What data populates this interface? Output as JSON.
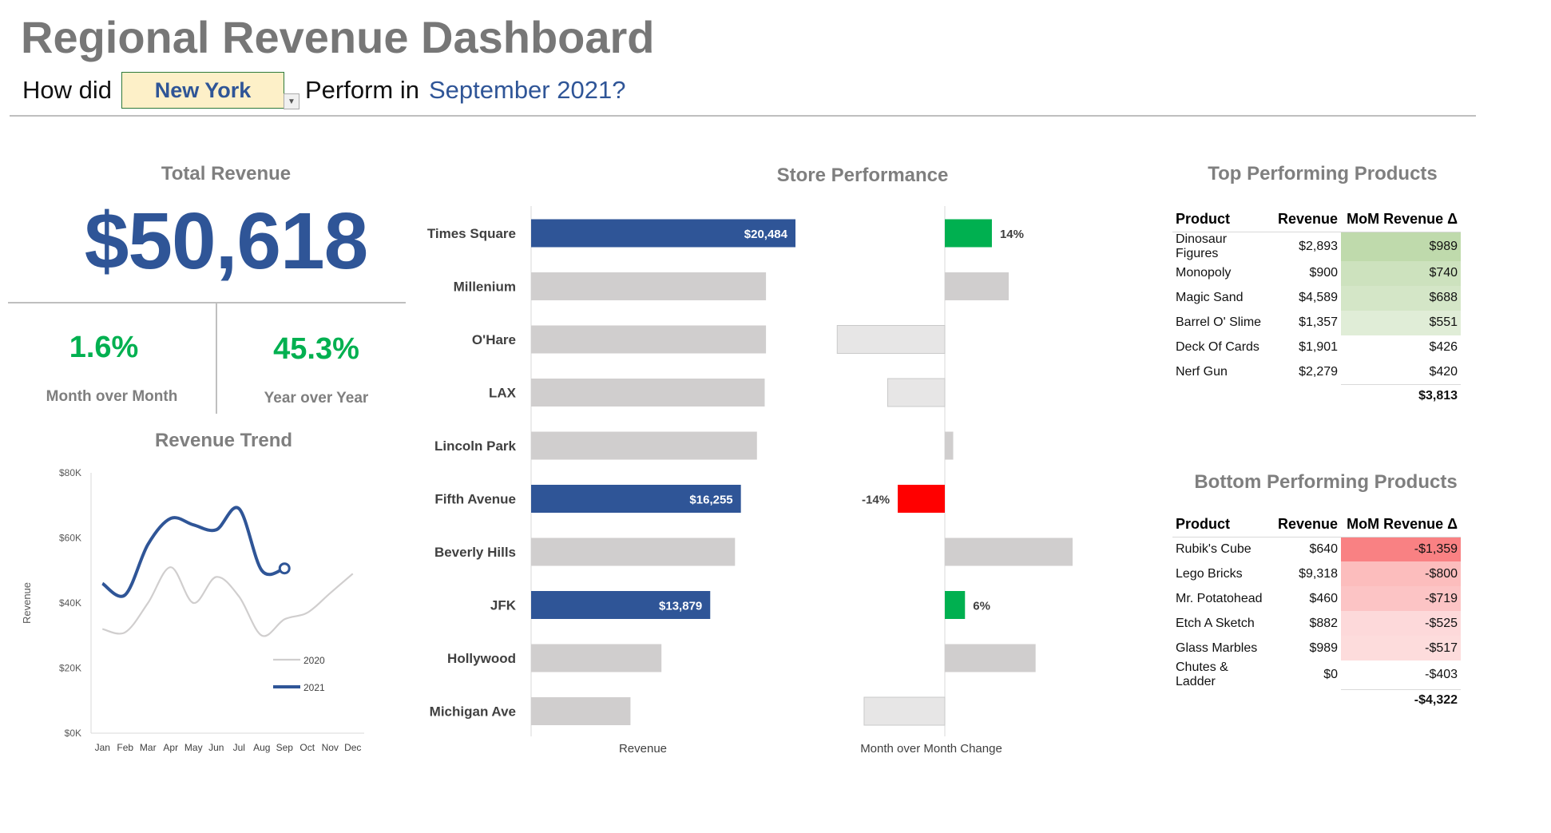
{
  "header": {
    "title": "Regional Revenue Dashboard",
    "question_prefix": "How did",
    "selected_city": "New York",
    "question_middle": "Perform in",
    "period": "September 2021?"
  },
  "total_revenue": {
    "title": "Total Revenue",
    "value": "$50,618",
    "mom_value": "1.6%",
    "mom_label": "Month over Month",
    "yoy_value": "45.3%",
    "yoy_label": "Year over Year"
  },
  "colors": {
    "accent_blue": "#2f5597",
    "positive_green": "#00b050",
    "negative_red": "#ff0000",
    "bar_grey": "#d0cece",
    "light_grey": "#e7e6e6",
    "title_grey": "#7f7f7f"
  },
  "chart_data": [
    {
      "type": "line",
      "title": "Revenue Trend",
      "ylabel": "Revenue",
      "categories": [
        "Jan",
        "Feb",
        "Mar",
        "Apr",
        "May",
        "Jun",
        "Jul",
        "Aug",
        "Sep",
        "Oct",
        "Nov",
        "Dec"
      ],
      "y_ticks": [
        "$0K",
        "$20K",
        "$40K",
        "$60K",
        "$80K"
      ],
      "ylim": [
        0,
        80000
      ],
      "legend_position": "bottom-right",
      "series": [
        {
          "name": "2020",
          "color": "#d0cece",
          "values": [
            32000,
            31000,
            40000,
            51000,
            40000,
            48000,
            42000,
            30000,
            35000,
            37000,
            43000,
            49000
          ]
        },
        {
          "name": "2021",
          "color": "#2f5597",
          "values": [
            46000,
            42500,
            58000,
            66000,
            64000,
            62500,
            69000,
            50000,
            50618,
            null,
            null,
            null
          ]
        }
      ]
    },
    {
      "type": "bar",
      "title": "Store Performance",
      "xlabel": "Revenue",
      "orientation": "horizontal",
      "categories": [
        "Times Square",
        "Millenium",
        "O'Hare",
        "LAX",
        "Lincoln Park",
        "Fifth Avenue",
        "Beverly Hills",
        "JFK",
        "Hollywood",
        "Michigan Ave"
      ],
      "values": [
        20484,
        18200,
        18200,
        18100,
        17500,
        16255,
        15800,
        13879,
        10100,
        7700
      ],
      "highlighted": [
        true,
        false,
        false,
        false,
        false,
        true,
        false,
        true,
        false,
        false
      ],
      "value_labels": [
        "$20,484",
        "",
        "",
        "",
        "",
        "$16,255",
        "",
        "$13,879",
        "",
        ""
      ]
    },
    {
      "type": "bar",
      "title": "",
      "xlabel": "Month over Month Change",
      "orientation": "horizontal",
      "categories": [
        "Times Square",
        "Millenium",
        "O'Hare",
        "LAX",
        "Lincoln Park",
        "Fifth Avenue",
        "Beverly Hills",
        "JFK",
        "Hollywood",
        "Michigan Ave"
      ],
      "values": [
        14,
        19,
        -32,
        -17,
        2.5,
        -14,
        38,
        6,
        27,
        -24
      ],
      "highlighted": [
        true,
        false,
        false,
        false,
        false,
        true,
        false,
        true,
        false,
        false
      ],
      "value_labels": [
        "14%",
        "",
        "",
        "",
        "",
        "-14%",
        "",
        "6%",
        "",
        ""
      ]
    }
  ],
  "top_products": {
    "title": "Top Performing Products",
    "columns": [
      "Product",
      "Revenue",
      "MoM Revenue Δ"
    ],
    "rows": [
      {
        "product": "Dinosaur Figures",
        "revenue": "$2,893",
        "delta": "$989",
        "intensity": 1.0
      },
      {
        "product": "Monopoly",
        "revenue": "$900",
        "delta": "$740",
        "intensity": 0.7
      },
      {
        "product": "Magic Sand",
        "revenue": "$4,589",
        "delta": "$688",
        "intensity": 0.55
      },
      {
        "product": "Barrel O' Slime",
        "revenue": "$1,357",
        "delta": "$551",
        "intensity": 0.3
      },
      {
        "product": "Deck Of Cards",
        "revenue": "$1,901",
        "delta": "$426",
        "intensity": 0.0
      },
      {
        "product": "Nerf Gun",
        "revenue": "$2,279",
        "delta": "$420",
        "intensity": 0.0
      }
    ],
    "total": "$3,813"
  },
  "bottom_products": {
    "title": "Bottom Performing Products",
    "columns": [
      "Product",
      "Revenue",
      "MoM Revenue Δ"
    ],
    "rows": [
      {
        "product": "Rubik's Cube",
        "revenue": "$640",
        "delta": "-$1,359",
        "intensity": 1.0
      },
      {
        "product": "Lego Bricks",
        "revenue": "$9,318",
        "delta": "-$800",
        "intensity": 0.45
      },
      {
        "product": "Mr. Potatohead",
        "revenue": "$460",
        "delta": "-$719",
        "intensity": 0.38
      },
      {
        "product": "Etch A Sketch",
        "revenue": "$882",
        "delta": "-$525",
        "intensity": 0.18
      },
      {
        "product": "Glass Marbles",
        "revenue": "$989",
        "delta": "-$517",
        "intensity": 0.16
      },
      {
        "product": "Chutes & Ladder",
        "revenue": "$0",
        "delta": "-$403",
        "intensity": 0.0
      }
    ],
    "total": "-$4,322"
  }
}
